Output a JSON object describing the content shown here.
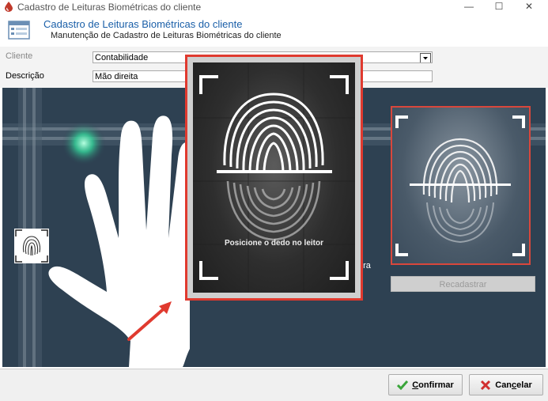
{
  "window": {
    "title": "Cadastro de Leituras Biométricas do cliente",
    "minimize_glyph": "—",
    "maximize_glyph": "☐",
    "close_glyph": "✕"
  },
  "header": {
    "title": "Cadastro de Leituras Biométricas do cliente",
    "subtitle": "Manutenção de Cadastro de Leituras Biométricas do cliente"
  },
  "form": {
    "cliente_label": "Cliente",
    "cliente_value": "Contabilidade",
    "descricao_label": "Descrição",
    "descricao_value": "Mão direita"
  },
  "capture": {
    "popup_message": "Posicione o dedo no leitor",
    "partial_label": "ura",
    "recadastrar_label": "Recadastrar"
  },
  "footer": {
    "confirmar_prefix": "",
    "confirmar_underlined": "C",
    "confirmar_rest": "onfirmar",
    "cancelar_prefix": "Can",
    "cancelar_underlined": "c",
    "cancelar_rest": "elar"
  },
  "colors": {
    "accent_red": "#e03a2f",
    "header_blue": "#1a5fa8",
    "scene_bg": "#2e4152"
  }
}
